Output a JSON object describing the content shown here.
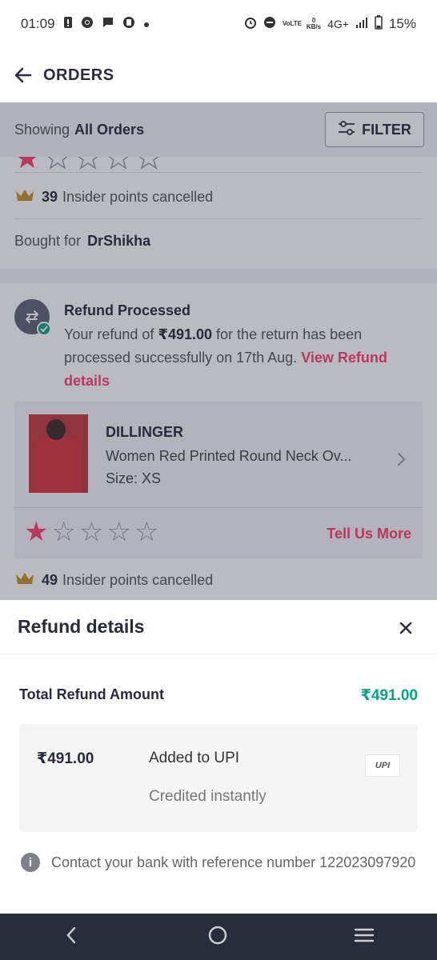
{
  "status_bar": {
    "time": "01:09",
    "network": "4G+",
    "speed_value": "0",
    "speed_unit": "KB/s",
    "volte": "VoLTE",
    "battery": "15%"
  },
  "header": {
    "title": "ORDERS",
    "back_icon": "arrow-left-icon"
  },
  "filter_bar": {
    "showing_label": "Showing",
    "showing_value": "All Orders",
    "filter_label": "FILTER"
  },
  "order1": {
    "insider_points": "39",
    "insider_text": "Insider points cancelled",
    "bought_for_label": "Bought for",
    "bought_for_name": "DrShikha"
  },
  "order2": {
    "status_title": "Refund Processed",
    "refund_text_1": "Your refund of",
    "refund_amount": "₹491.00",
    "refund_text_2": "for the return has been processed successfully on 17th Aug.",
    "refund_link": "View Refund details",
    "brand": "DILLINGER",
    "product_name": "Women Red Printed Round Neck Ov...",
    "size": "Size: XS",
    "rating": 1,
    "rating_max": 5,
    "tell_more": "Tell Us More",
    "insider_points": "49",
    "insider_text": "Insider points cancelled"
  },
  "sheet": {
    "title": "Refund details",
    "total_label": "Total Refund Amount",
    "total_amount": "₹491.00",
    "entry_amount": "₹491.00",
    "entry_mode": "Added to UPI",
    "entry_note": "Credited instantly",
    "upi_logo_text": "UPI",
    "info_text": "Contact your bank with reference number 122023097920"
  },
  "colors": {
    "accent_pink": "#ff3f6c",
    "success_green": "#03a685",
    "text_dark": "#282c3f",
    "nav_bg": "#292c3a"
  }
}
